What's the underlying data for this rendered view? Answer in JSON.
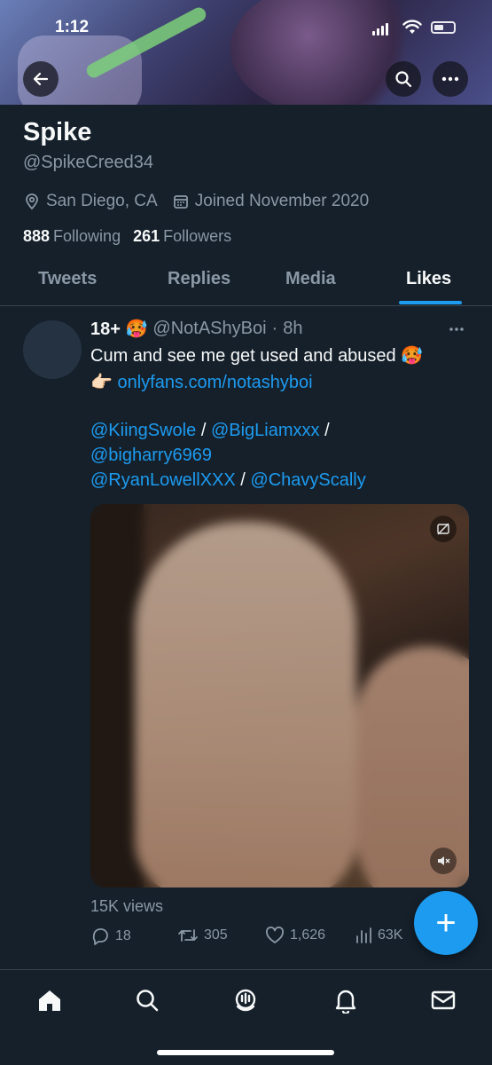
{
  "status_bar": {
    "time": "1:12"
  },
  "profile": {
    "name": "Spike",
    "handle": "@SpikeCreed34",
    "location": "San Diego, CA",
    "joined": "Joined November 2020",
    "following_count": "888",
    "following_label": "Following",
    "followers_count": "261",
    "followers_label": "Followers"
  },
  "tabs": [
    {
      "label": "Tweets"
    },
    {
      "label": "Replies"
    },
    {
      "label": "Media"
    },
    {
      "label": "Likes",
      "active": true
    }
  ],
  "tweet": {
    "display_name": "18+ 🥵",
    "username": "@NotAShyBoi",
    "dot": "·",
    "time": "8h",
    "text_line1": "Cum and see me get used and abused 🥵",
    "pointer": "👉🏻",
    "link": "onlyfans.com/notashyboi",
    "mentions": [
      "@KiingSwole",
      "@BigLiamxxx",
      "@bigharry6969",
      "@RyanLowellXXX",
      "@ChavyScally"
    ],
    "separator": "/",
    "views": "15K views",
    "replies": "18",
    "retweets": "305",
    "likes": "1,626",
    "analytics": "63K"
  },
  "fab": {
    "label": "+"
  },
  "colors": {
    "background": "#15202b",
    "accent": "#1d9bf0",
    "muted": "#8b98a5",
    "divider": "#38444d"
  },
  "icons": {
    "back": "arrow-left-icon",
    "search": "search-icon",
    "more": "more-icon",
    "location": "location-pin-icon",
    "calendar": "calendar-icon",
    "nav": [
      "home-icon",
      "search-icon",
      "spaces-icon",
      "bell-icon",
      "mail-icon"
    ]
  }
}
